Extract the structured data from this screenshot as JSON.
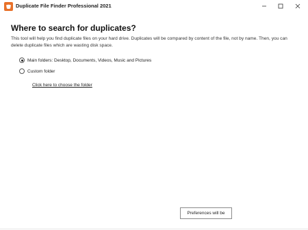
{
  "window": {
    "title": "Duplicate File Finder Professional 2021",
    "app_icon": "duplicate-file-finder-app-icon",
    "accent_color": "#e8712a",
    "controls": [
      "minimize-icon",
      "maximize-icon",
      "close-icon"
    ]
  },
  "main": {
    "heading": "Where to search for duplicates?",
    "description": "This tool will help you find duplicate files on your hard drive. Duplicates will be compared by content of the file, not by name. Then, you can delete duplicate files which are wasting disk space.",
    "options": [
      {
        "label": "Main folders: Desktop, Documents, Videos, Music and Pictures",
        "selected": true
      },
      {
        "label": "Custom folder",
        "selected": false
      }
    ],
    "choose_folder_link": "Click here to choose the folder"
  },
  "footer": {
    "preferences_label": "Preferences will be"
  }
}
